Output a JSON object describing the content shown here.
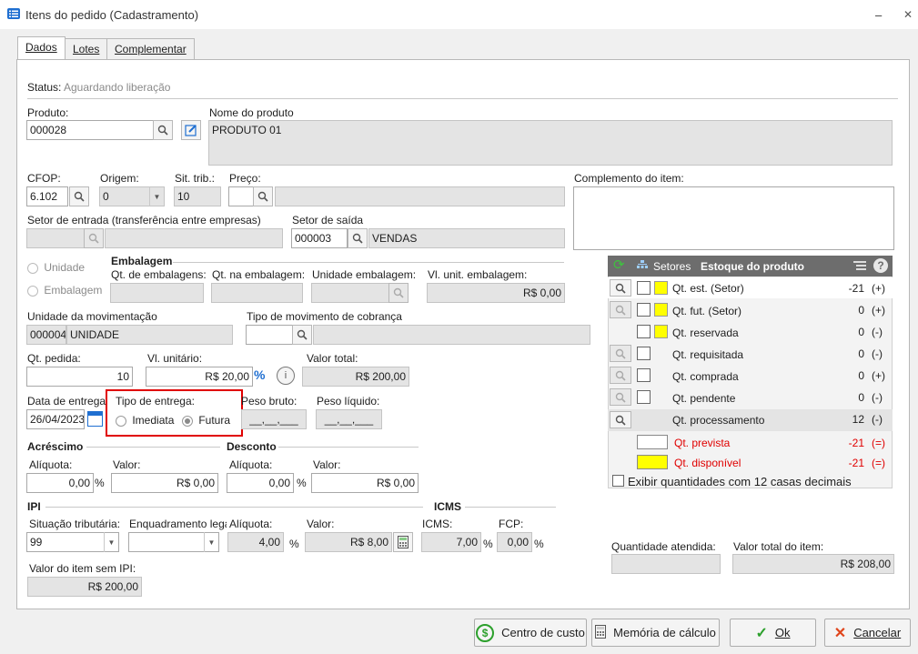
{
  "window": {
    "title": "Itens do pedido (Cadastramento)",
    "minimize": "–",
    "close": "✕"
  },
  "tabs": [
    {
      "label": "Dados"
    },
    {
      "label": "Lotes"
    },
    {
      "label": "Complementar"
    }
  ],
  "status": {
    "label": "Status:",
    "value": "Aguardando liberação"
  },
  "produto": {
    "label": "Produto:",
    "value": "000028"
  },
  "nome_produto": {
    "label": "Nome do produto",
    "value": "PRODUTO 01"
  },
  "cfop": {
    "label": "CFOP:",
    "value": "6.102"
  },
  "origem": {
    "label": "Origem:",
    "value": "0"
  },
  "sit_trib": {
    "label": "Sit. trib.:",
    "value": "10"
  },
  "preco": {
    "label": "Preço:",
    "value": ""
  },
  "complemento": {
    "label": "Complemento do item:",
    "value": ""
  },
  "setor_entrada": {
    "label": "Setor de entrada (transferência entre empresas)",
    "code": "",
    "name": ""
  },
  "setor_saida": {
    "label": "Setor de saída",
    "code": "000003",
    "name": "VENDAS"
  },
  "embalagem": {
    "title": "Embalagem",
    "radio_unidade": "Unidade",
    "radio_embalagem": "Embalagem",
    "qt_embalagens_label": "Qt. de embalagens:",
    "qt_na_embalagem_label": "Qt. na embalagem:",
    "unidade_embalagem_label": "Unidade embalagem:",
    "vl_unit_embalagem_label": "Vl. unit. embalagem:",
    "vl_unit_embalagem_value": "R$ 0,00"
  },
  "unidade_mov": {
    "label": "Unidade da movimentação",
    "code": "000004",
    "name": "UNIDADE"
  },
  "tipo_mov_cobranca": {
    "label": "Tipo de movimento de cobrança"
  },
  "qt_pedida": {
    "label": "Qt. pedida:",
    "value": "10"
  },
  "vl_unitario": {
    "label": "Vl. unitário:",
    "value": "R$ 20,00"
  },
  "valor_total": {
    "label": "Valor total:",
    "value": "R$ 200,00"
  },
  "data_entrega": {
    "label": "Data de entrega",
    "value": "26/04/2023"
  },
  "tipo_entrega": {
    "label": "Tipo de entrega:",
    "imediata": "Imediata",
    "futura": "Futura"
  },
  "peso_bruto": {
    "label": "Peso bruto:",
    "value": "__,__,___"
  },
  "peso_liquido": {
    "label": "Peso líquido:",
    "value": "__,__,___"
  },
  "acrescimo": {
    "title": "Acréscimo",
    "aliquota_label": "Alíquota:",
    "aliquota_value": "0,00",
    "valor_label": "Valor:",
    "valor_value": "R$ 0,00",
    "percent": "%"
  },
  "desconto": {
    "title": "Desconto",
    "aliquota_label": "Alíquota:",
    "aliquota_value": "0,00",
    "valor_label": "Valor:",
    "valor_value": "R$ 0,00",
    "percent": "%"
  },
  "ipi": {
    "title": "IPI",
    "situacao_label": "Situação tributária:",
    "situacao_value": "99",
    "enquadramento_label": "Enquadramento legal:",
    "aliquota_label": "Alíquota:",
    "aliquota_value": "4,00",
    "percent": "%",
    "valor_label": "Valor:",
    "valor_value": "R$ 8,00",
    "sem_ipi_label": "Valor do item sem IPI:",
    "sem_ipi_value": "R$ 200,00"
  },
  "icms": {
    "title": "ICMS",
    "icms_label": "ICMS:",
    "icms_value": "7,00",
    "fcp_label": "FCP:",
    "fcp_value": "0,00",
    "percent": "%"
  },
  "estoque": {
    "setores_label": "Setores",
    "title": "Estoque do produto",
    "rows": [
      {
        "label": "Qt. est. (Setor)",
        "value": "-21",
        "sign": "(+)"
      },
      {
        "label": "Qt. fut. (Setor)",
        "value": "0",
        "sign": "(+)"
      },
      {
        "label": "Qt. reservada",
        "value": "0",
        "sign": "(-)"
      },
      {
        "label": "Qt. requisitada",
        "value": "0",
        "sign": "(-)"
      },
      {
        "label": "Qt. comprada",
        "value": "0",
        "sign": "(+)"
      },
      {
        "label": "Qt. pendente",
        "value": "0",
        "sign": "(-)"
      },
      {
        "label": "Qt. processamento",
        "value": "12",
        "sign": "(-)"
      }
    ],
    "prevista": {
      "label": "Qt. prevista",
      "value": "-21",
      "sign": "(=)"
    },
    "disponivel": {
      "label": "Qt. disponível",
      "value": "-21",
      "sign": "(=)"
    },
    "decimais_label": "Exibir quantidades com 12 casas decimais"
  },
  "quantidade_atendida": {
    "label": "Quantidade atendida:",
    "value": ""
  },
  "valor_total_item": {
    "label": "Valor total do item:",
    "value": "R$ 208,00"
  },
  "buttons": {
    "centro_custo": "Centro de custo",
    "memoria": "Memória de cálculo",
    "ok": "Ok",
    "cancelar": "Cancelar"
  },
  "colors": {
    "highlight_border": "#e00000",
    "yellow": "#ffff00",
    "stock_header": "#6d6d6d"
  }
}
